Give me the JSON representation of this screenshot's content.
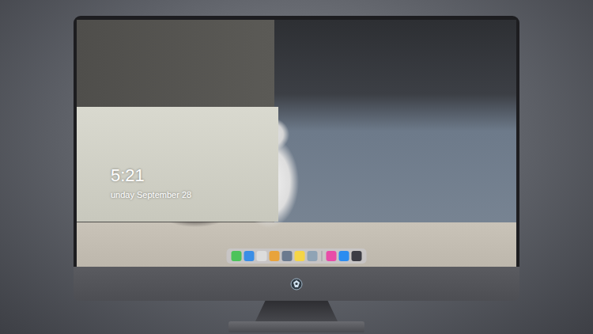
{
  "screen": {
    "clock": "5:21",
    "date": "unday September 28"
  },
  "dock": {
    "items": [
      {
        "kind": "app",
        "color": "#4cc35a"
      },
      {
        "kind": "app",
        "color": "#3a8ee6"
      },
      {
        "kind": "app",
        "color": "#dcdcdc"
      },
      {
        "kind": "app",
        "color": "#e8a33c"
      },
      {
        "kind": "app",
        "color": "#6b7a8f"
      },
      {
        "kind": "app",
        "color": "#f5d547"
      },
      {
        "kind": "app",
        "color": "#8fa3b5"
      },
      {
        "kind": "separator",
        "color": "#9a9aa0"
      },
      {
        "kind": "app",
        "color": "#e84ca8"
      },
      {
        "kind": "app",
        "color": "#2b8cf0"
      },
      {
        "kind": "app",
        "color": "#3c3c44"
      }
    ]
  }
}
